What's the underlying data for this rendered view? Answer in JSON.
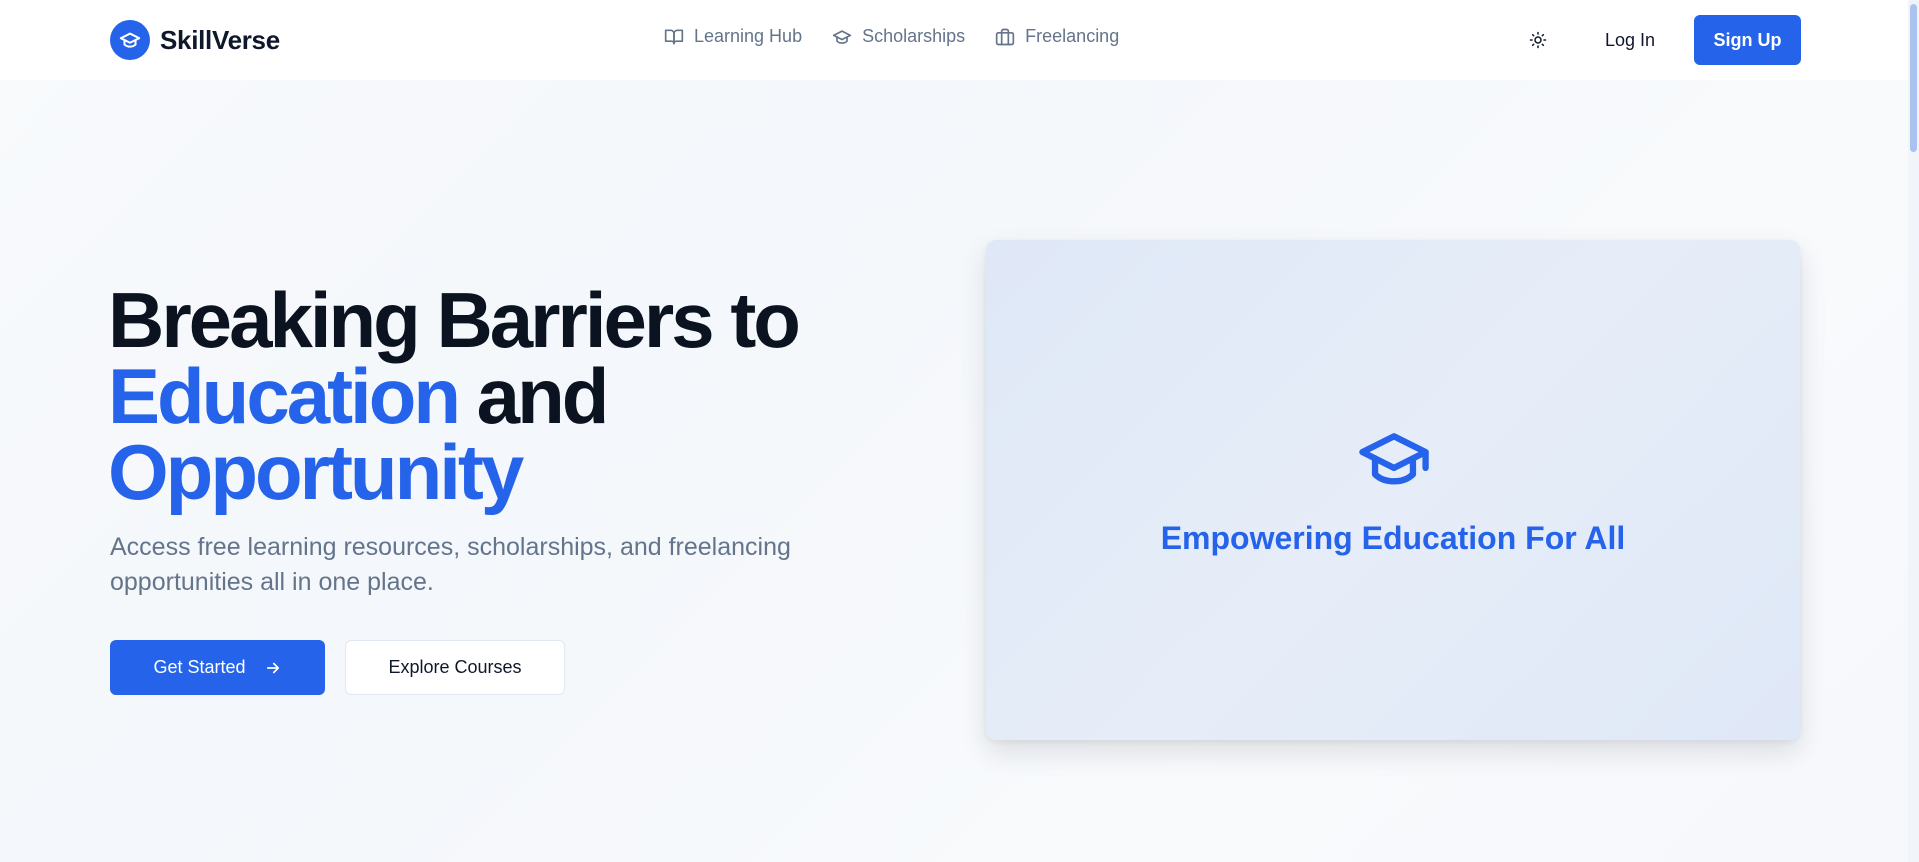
{
  "header": {
    "brand_name": "SkillVerse",
    "brand_icon": "graduation-cap-icon",
    "nav": [
      {
        "label": "Learning Hub",
        "icon": "book-open-icon"
      },
      {
        "label": "Scholarships",
        "icon": "graduation-cap-icon"
      },
      {
        "label": "Freelancing",
        "icon": "briefcase-icon"
      }
    ],
    "theme_icon": "sun-icon",
    "login_label": "Log In",
    "signup_label": "Sign Up"
  },
  "hero": {
    "title_line1": "Breaking Barriers to",
    "title_accent1": "Education",
    "title_mid": " and",
    "title_accent2": "Opportunity",
    "subtitle": "Access free learning resources, scholarships, and freelancing opportunities all in one place.",
    "primary_button": "Get Started",
    "primary_icon": "arrow-right-icon",
    "secondary_button": "Explore Courses"
  },
  "card": {
    "icon": "graduation-cap-icon",
    "title": "Empowering Education For All"
  },
  "colors": {
    "accent": "#2563eb",
    "heading": "#0b1220",
    "muted": "#64748b"
  }
}
